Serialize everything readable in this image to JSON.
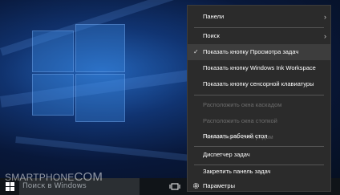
{
  "search": {
    "placeholder": "Поиск в Windows"
  },
  "watermark": {
    "text_left": "SMARTPHONE",
    "text_right": "COM"
  },
  "context_menu": {
    "items": [
      {
        "label": "Панели",
        "submenu": true
      },
      {
        "label": "Поиск",
        "submenu": true
      },
      {
        "label": "Показать кнопку Просмотра задач",
        "checked": true
      },
      {
        "label": "Показать кнопку Windows Ink Workspace"
      },
      {
        "label": "Показать кнопку сенсорной клавиатуры"
      },
      {
        "label": "Расположить окна каскадом",
        "disabled": true
      },
      {
        "label": "Расположить окна стопкой",
        "disabled": true
      },
      {
        "label": "Расположить окна рядом",
        "disabled": true
      },
      {
        "label": "Показать рабочий стол"
      },
      {
        "label": "Диспетчер задач"
      },
      {
        "label": "Закрепить панель задач"
      },
      {
        "label": "Параметры",
        "icon": "gear-icon"
      }
    ]
  },
  "icons": {
    "submenu": "chevron-right-icon",
    "check": "checkmark-icon",
    "start": "windows-logo-icon",
    "taskview": "task-view-icon"
  },
  "colors": {
    "menu_bg": "#2b2b2b",
    "highlight": "#3d3d3d",
    "disabled_text": "#6d6d6d",
    "taskbar": "#101418"
  }
}
